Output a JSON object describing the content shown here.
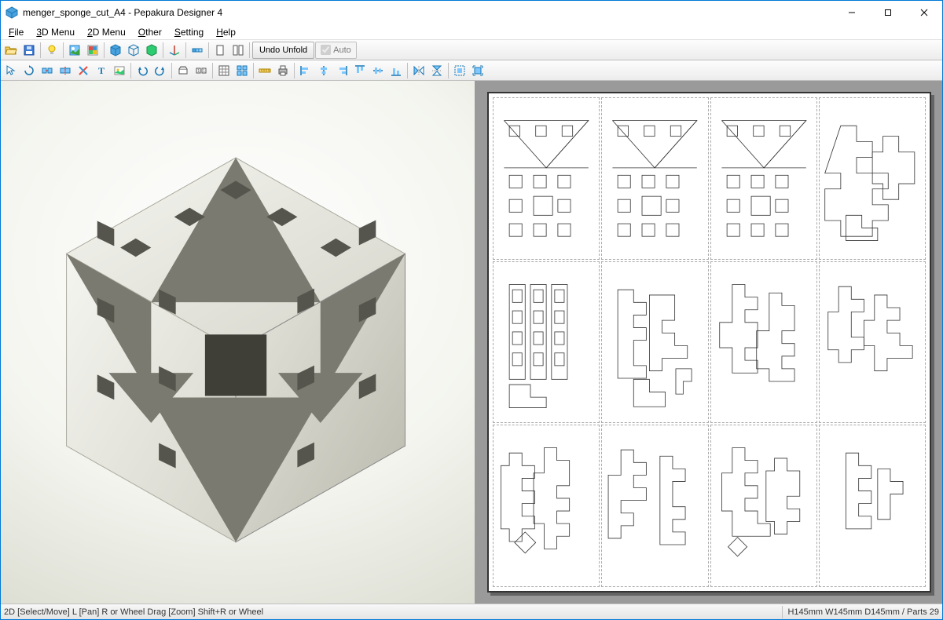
{
  "titlebar": {
    "title": "menger_sponge_cut_A4 - Pepakura Designer 4"
  },
  "menu": {
    "file": "File",
    "menu3d": "3D Menu",
    "menu2d": "2D Menu",
    "other": "Other",
    "setting": "Setting",
    "help": "Help"
  },
  "toolbar": {
    "undo_unfold": "Undo Unfold",
    "auto_label": "Auto"
  },
  "status": {
    "left": "2D [Select/Move] L [Pan] R or Wheel Drag [Zoom] Shift+R or Wheel",
    "right": "H145mm W145mm D145mm / Parts 29"
  }
}
